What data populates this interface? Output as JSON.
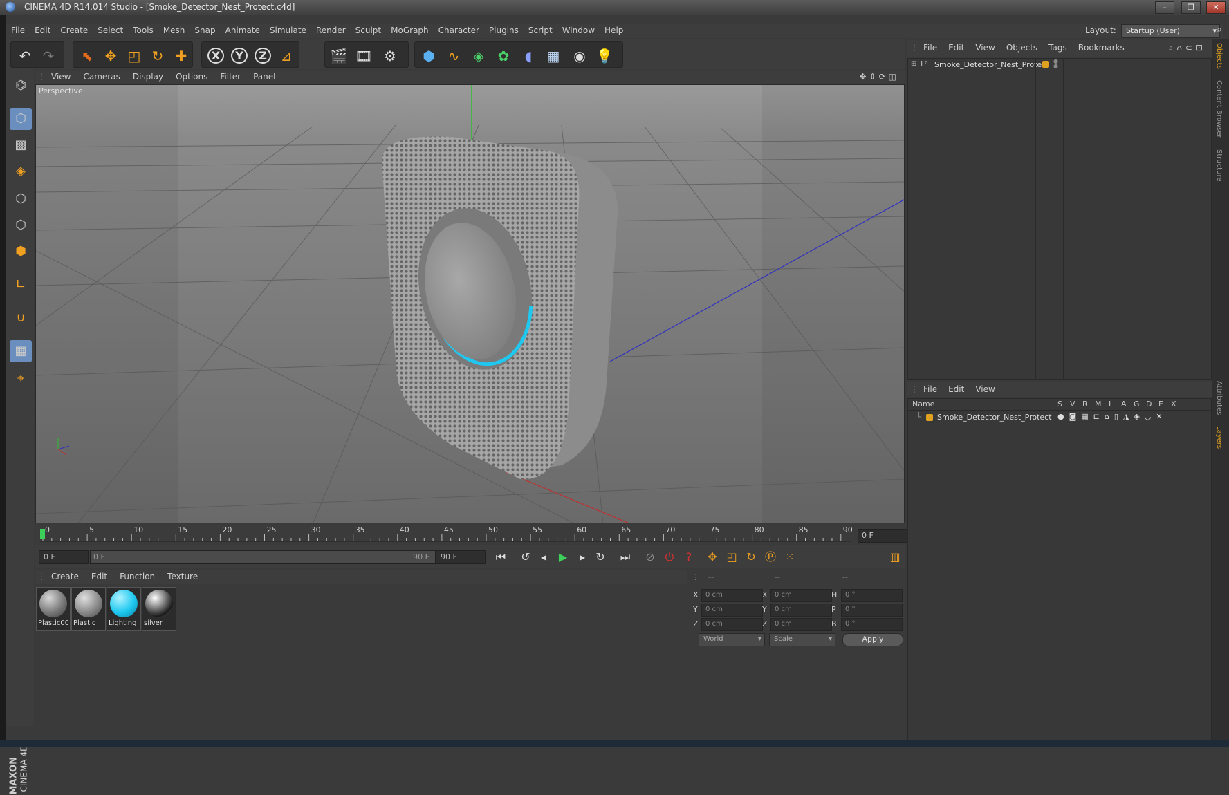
{
  "window": {
    "title": "CINEMA 4D R14.014 Studio - [Smoke_Detector_Nest_Protect.c4d]"
  },
  "menubar": {
    "items": [
      "File",
      "Edit",
      "Create",
      "Select",
      "Tools",
      "Mesh",
      "Snap",
      "Animate",
      "Simulate",
      "Render",
      "Sculpt",
      "MoGraph",
      "Character",
      "Plugins",
      "Script",
      "Window",
      "Help"
    ],
    "layout_label": "Layout:",
    "layout_value": "Startup (User)"
  },
  "toolbar": {
    "icons": [
      "undo-icon",
      "redo-icon",
      "live-selection-icon",
      "move-icon",
      "scale-icon",
      "rotate-icon",
      "add-object-icon",
      "x-axis-icon",
      "y-axis-icon",
      "z-axis-icon",
      "coordinate-system-icon",
      "render-view-icon",
      "render-to-picture-viewer-icon",
      "render-settings-icon",
      "cube-icon",
      "spline-icon",
      "nurbs-icon",
      "array-icon",
      "deformer-icon",
      "floor-icon",
      "camera-icon",
      "light-icon"
    ],
    "axes": [
      "X",
      "Y",
      "Z"
    ]
  },
  "viewport": {
    "menu": [
      "View",
      "Cameras",
      "Display",
      "Options",
      "Filter",
      "Panel"
    ],
    "label": "Perspective"
  },
  "timeline": {
    "ticks": [
      "0",
      "5",
      "10",
      "15",
      "20",
      "25",
      "30",
      "35",
      "40",
      "45",
      "50",
      "55",
      "60",
      "65",
      "70",
      "75",
      "80",
      "85",
      "90"
    ],
    "current_frame": "0 F",
    "start_field": "0 F",
    "range_start": "0 F",
    "range_end": "90 F",
    "end_field": "90 F"
  },
  "materials": {
    "menu": [
      "Create",
      "Edit",
      "Function",
      "Texture"
    ],
    "items": [
      {
        "label": "Plastic00",
        "color": "#8a8a8a"
      },
      {
        "label": "Plastic",
        "color": "#9a9a9a"
      },
      {
        "label": "Lighting",
        "color": "#1ec8f0"
      },
      {
        "label": "silver",
        "color": "#6a6a6a"
      }
    ]
  },
  "coordinates": {
    "headers": [
      "--",
      "--",
      "--"
    ],
    "rows": [
      {
        "a": "X",
        "av": "0 cm",
        "b": "X",
        "bv": "0 cm",
        "c": "H",
        "cv": "0 °"
      },
      {
        "a": "Y",
        "av": "0 cm",
        "b": "Y",
        "bv": "0 cm",
        "c": "P",
        "cv": "0 °"
      },
      {
        "a": "Z",
        "av": "0 cm",
        "b": "Z",
        "bv": "0 cm",
        "c": "B",
        "cv": "0 °"
      }
    ],
    "mode": "World",
    "scale": "Scale",
    "apply": "Apply"
  },
  "object_manager": {
    "menu": [
      "File",
      "Edit",
      "View",
      "Objects",
      "Tags",
      "Bookmarks"
    ],
    "object_name": "Smoke_Detector_Nest_Protect",
    "tag_color": "#e0a020"
  },
  "layer_manager": {
    "menu": [
      "File",
      "Edit",
      "View"
    ],
    "columns": [
      "Name",
      "S",
      "V",
      "R",
      "M",
      "L",
      "A",
      "G",
      "D",
      "E",
      "X"
    ],
    "layer_name": "Smoke_Detector_Nest_Protect"
  },
  "side_tabs": {
    "top": [
      "Objects",
      "Content Browser",
      "Structure"
    ],
    "bottom": [
      "Attributes",
      "Layers"
    ]
  },
  "brand": {
    "line1": "MAXON",
    "line2": "CINEMA 4D"
  },
  "colors": {
    "accent": "#6a8fbf",
    "ring": "#1ec8f0"
  }
}
